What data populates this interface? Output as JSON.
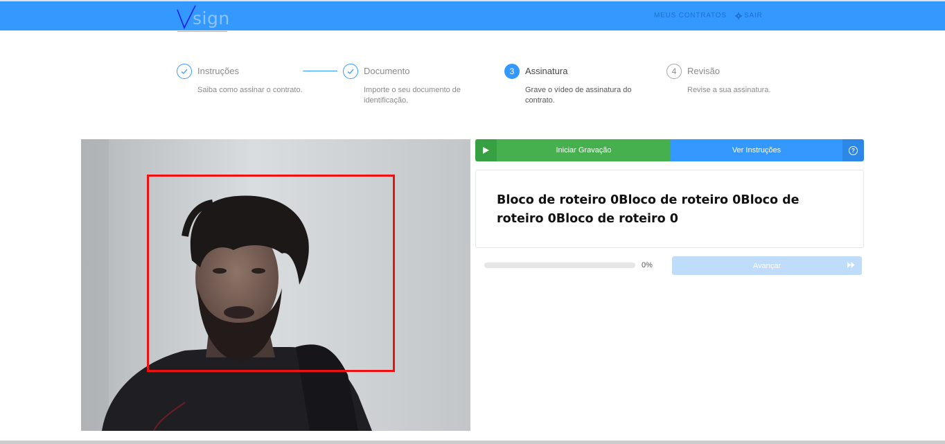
{
  "header": {
    "logo_text": "sign",
    "nav": {
      "contracts_label": "MEUS CONTRATOS",
      "logout_label": "SAIR"
    }
  },
  "steps": [
    {
      "number": "1",
      "title": "Instruções",
      "description": "Saiba como assinar o contrato.",
      "state": "done"
    },
    {
      "number": "2",
      "title": "Documento",
      "description": "Importe o seu documento de identificação.",
      "state": "done"
    },
    {
      "number": "3",
      "title": "Assinatura",
      "description": "Grave o vídeo de assinatura do contrato.",
      "state": "active"
    },
    {
      "number": "4",
      "title": "Revisão",
      "description": "Revise a sua assinatura.",
      "state": "pending"
    }
  ],
  "actions": {
    "record_label": "Iniciar Gravação",
    "instructions_label": "Ver Instruções"
  },
  "script": {
    "text": "Bloco de roteiro 0Bloco de roteiro 0Bloco de roteiro 0Bloco de roteiro 0"
  },
  "progress": {
    "value": 0,
    "label": "0%"
  },
  "next": {
    "label": "Avançar",
    "enabled": false
  },
  "colors": {
    "primary": "#3399ff",
    "success": "#46b04f",
    "face_box": "#ee1111"
  },
  "icons": {
    "done_step": "check-icon",
    "record": "play-icon",
    "help": "question-icon",
    "logout": "gear-icon",
    "next": "fast-forward-icon"
  }
}
